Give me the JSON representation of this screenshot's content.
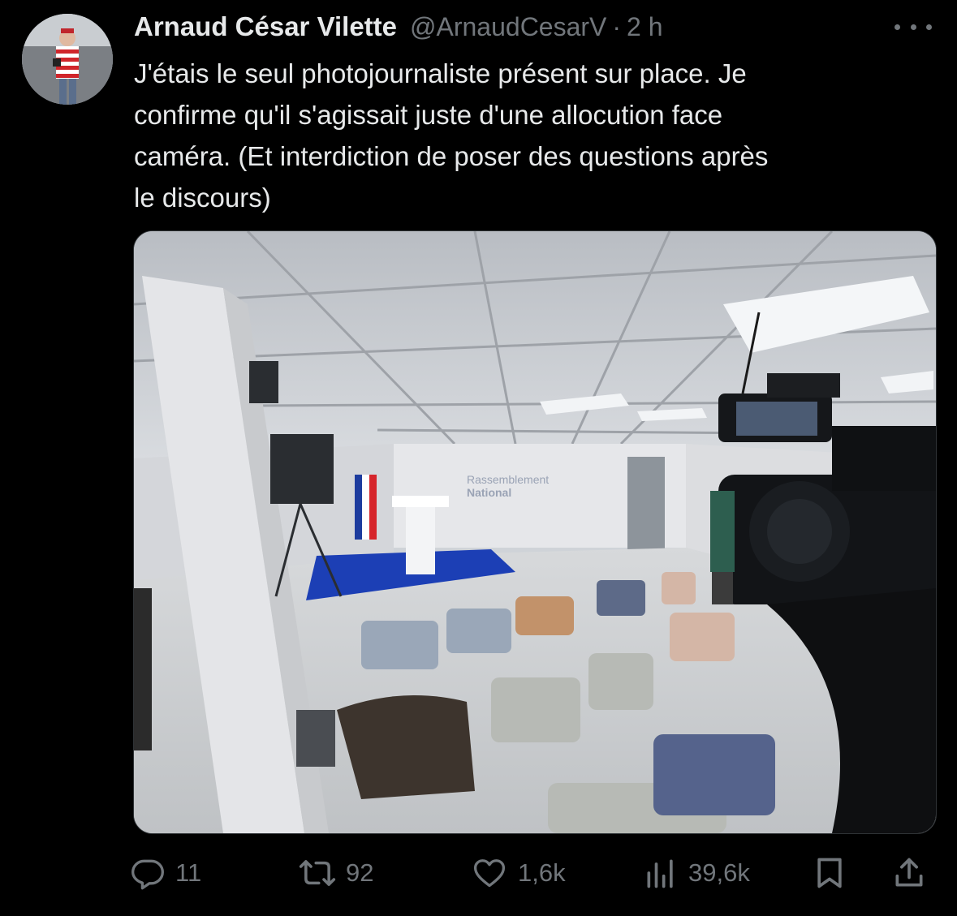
{
  "tweet": {
    "author_name": "Arnaud César Vilette",
    "handle": "@ArnaudCesarV",
    "separator": "·",
    "time": "2 h",
    "text_lines": [
      "J'étais le seul photojournaliste présent sur place. Je",
      "confirme qu'il s'agissait juste d'une allocution face",
      "caméra. (Et interdiction de poser des questions après",
      "le discours)"
    ],
    "media": {
      "backdrop_logo_line1": "Rassemblement",
      "backdrop_logo_line2": "National"
    }
  },
  "actions": {
    "replies": "11",
    "reposts": "92",
    "likes": "1,6k",
    "views": "39,6k"
  },
  "icons": {
    "reply": "reply-icon",
    "repost": "repost-icon",
    "like": "heart-icon",
    "views": "views-icon",
    "bookmark": "bookmark-icon",
    "share": "share-icon",
    "more": "more-icon"
  },
  "colors": {
    "background": "#000000",
    "primary_text": "#e7e9ea",
    "secondary_text": "#71767b"
  }
}
